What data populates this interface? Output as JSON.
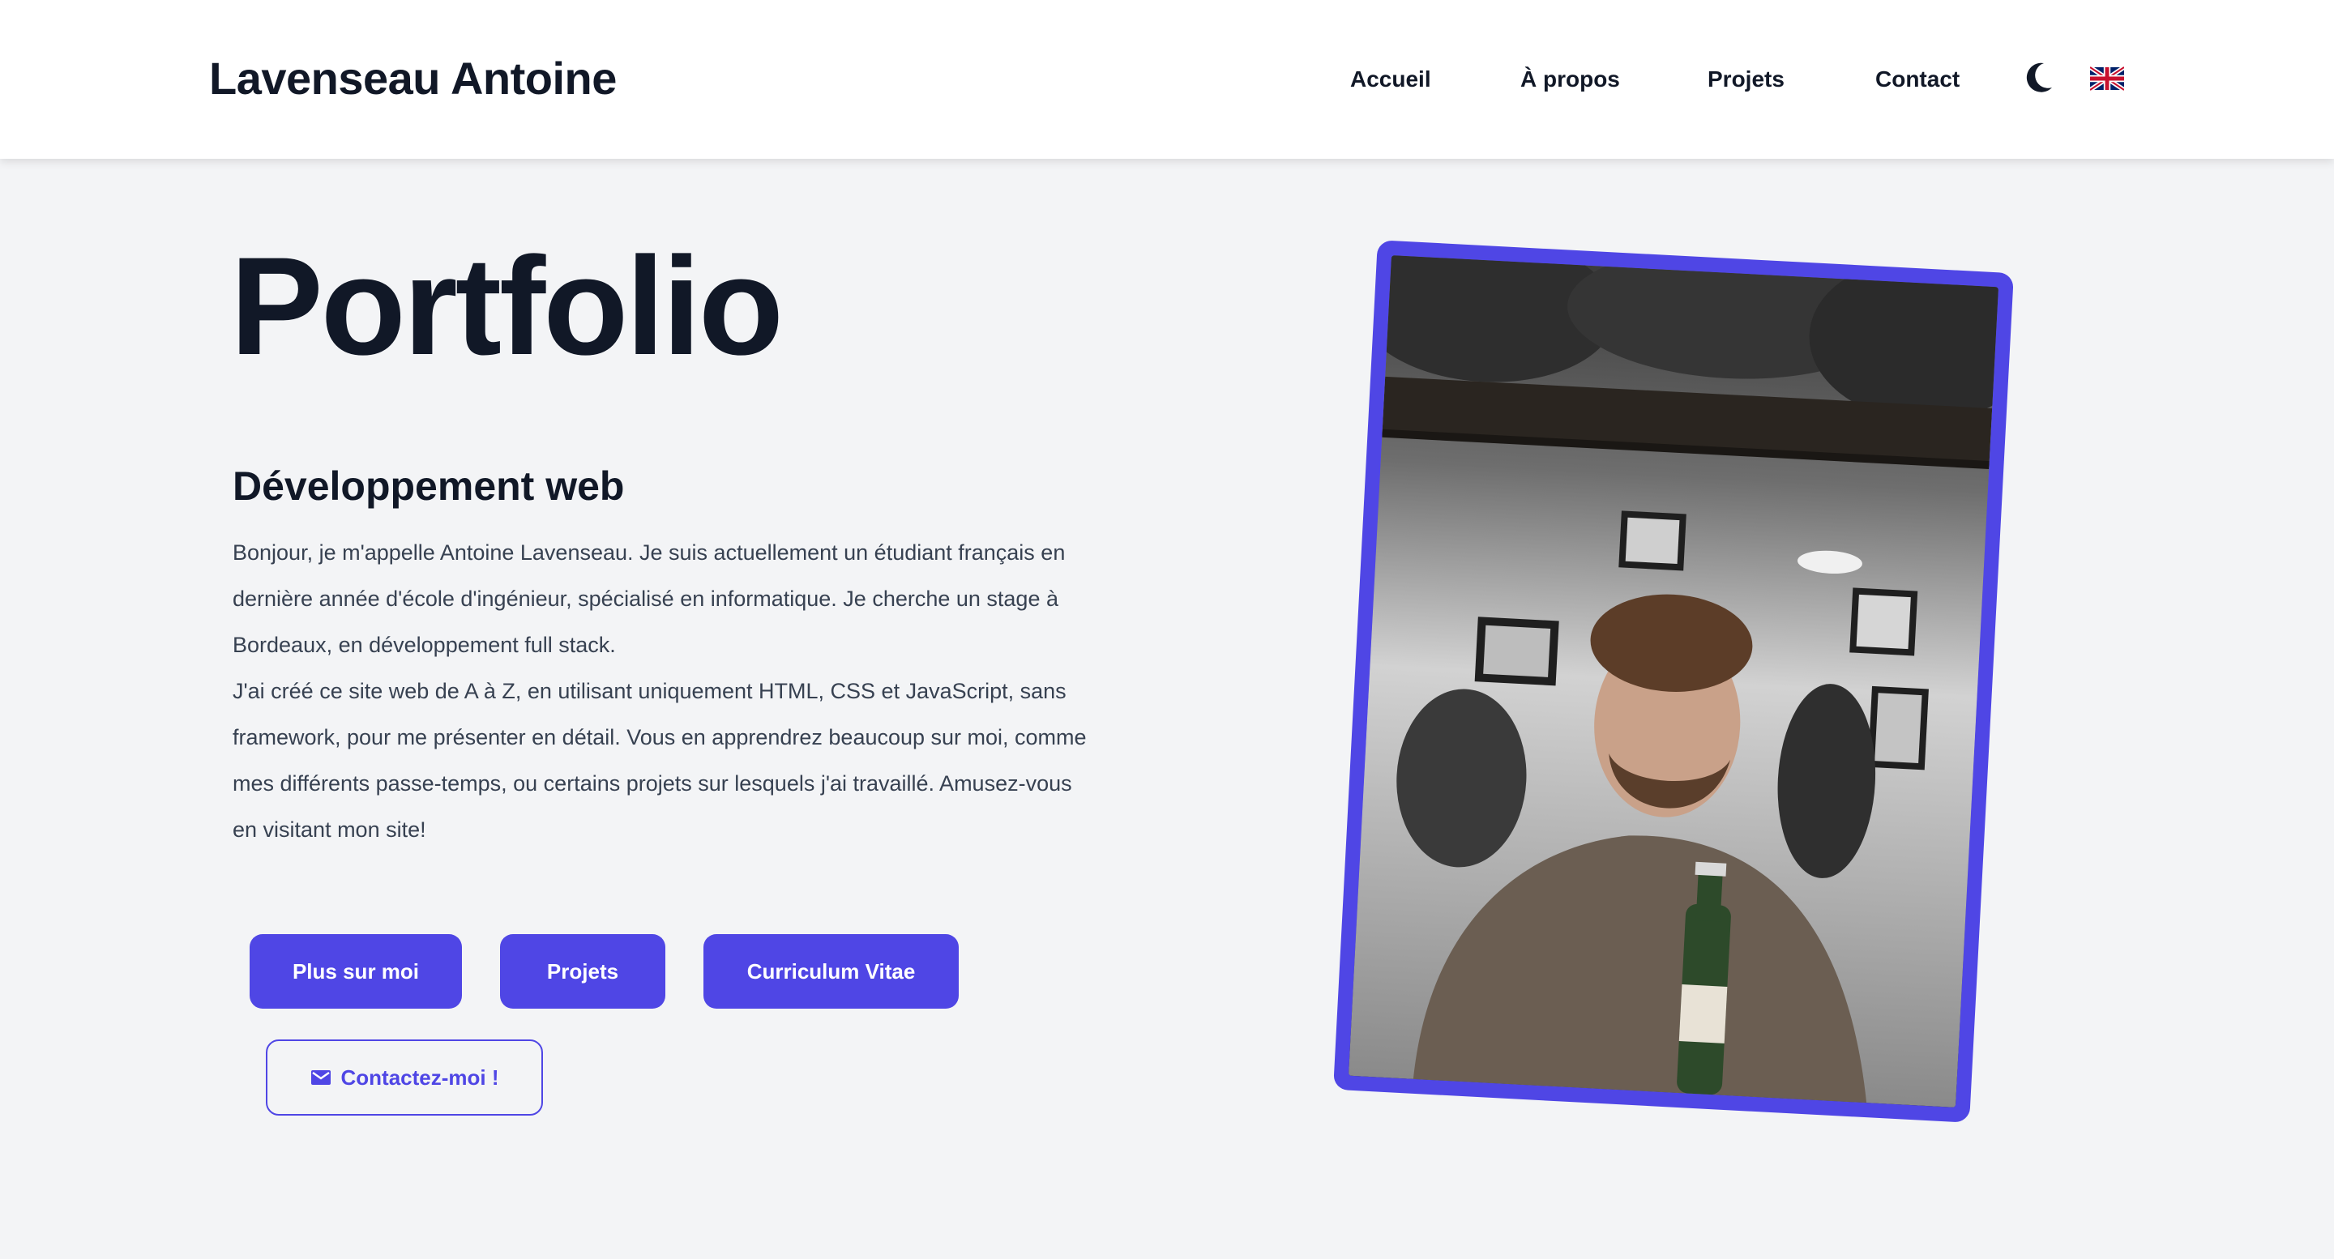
{
  "header": {
    "brand": "Lavenseau Antoine",
    "nav": [
      "Accueil",
      "À propos",
      "Projets",
      "Contact"
    ],
    "theme_icon": "moon-icon",
    "lang_icon": "uk-flag-icon"
  },
  "hero": {
    "title": "Portfolio",
    "subtitle": "Développement web",
    "intro_p1": "Bonjour, je m'appelle Antoine Lavenseau. Je suis actuellement un étudiant français en dernière année d'école d'ingénieur, spécialisé en informatique. Je cherche un stage à Bordeaux, en développement full stack.",
    "intro_p2": "J'ai créé ce site web de A à Z, en utilisant uniquement HTML, CSS et JavaScript, sans framework, pour me présenter en détail. Vous en apprendrez beaucoup sur moi, comme mes différents passe-temps, ou certains projets sur lesquels j'ai travaillé. Amusez-vous en visitant mon site!",
    "buttons": {
      "more": "Plus sur moi",
      "projects": "Projets",
      "cv": "Curriculum Vitae",
      "contact": "Contactez-moi !"
    },
    "contact_icon": "mail-icon",
    "photo_alt": "profile-photo"
  },
  "colors": {
    "accent": "#4f46e5",
    "background": "#f3f4f6",
    "header_bg": "#ffffff",
    "text": "#111827",
    "body_text": "#374151"
  }
}
